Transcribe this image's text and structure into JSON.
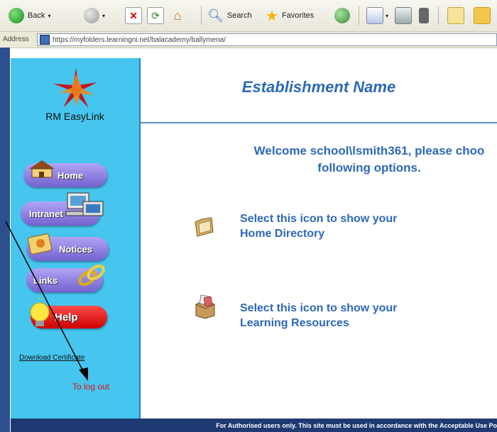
{
  "toolbar": {
    "back_label": "Back",
    "search_label": "Search",
    "favorites_label": "Favorites"
  },
  "address": {
    "label": "Address",
    "url": "https://myfolders.learningni.net/balacademy/ballymena/"
  },
  "sidebar": {
    "logo_text": "RM EasyLink",
    "items": [
      {
        "label": "Home"
      },
      {
        "label": "Intranet"
      },
      {
        "label": "Notices"
      },
      {
        "label": "Links"
      },
      {
        "label": "Help"
      }
    ],
    "download_label": "Download Certificate",
    "logout_text": "To log out"
  },
  "main": {
    "title": "Establishment Name",
    "welcome": "Welcome school\\lsmith361, please choo\nfollowing options.",
    "options": [
      {
        "text": "Select this icon to show your\nHome Directory",
        "icon": "folder-icon"
      },
      {
        "text": "Select this icon to show your\nLearning Resources",
        "icon": "resources-box-icon"
      }
    ]
  },
  "footer": {
    "text": "For Authorised users only. This site must be used in accordance with the Acceptable Use Po"
  },
  "colors": {
    "sidebar": "#46c5ee",
    "heading_blue": "#2e68b8",
    "footer": "#1f3a73",
    "logout_red": "#e01010"
  }
}
